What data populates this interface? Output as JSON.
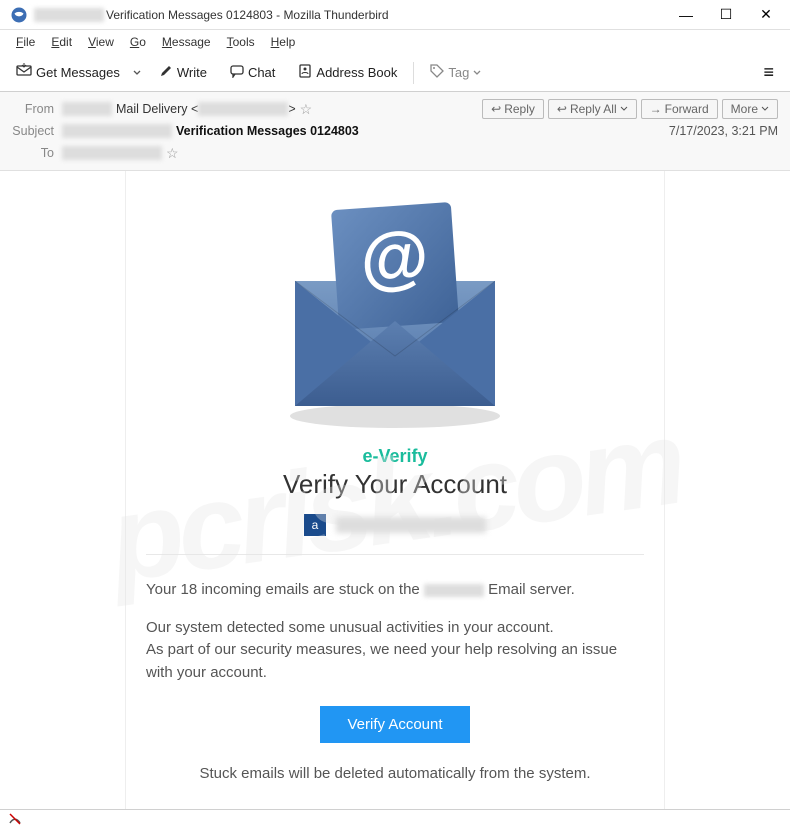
{
  "window": {
    "title_suffix": "Verification Messages 0124803 - Mozilla Thunderbird"
  },
  "menubar": {
    "file": "File",
    "edit": "Edit",
    "view": "View",
    "go": "Go",
    "message": "Message",
    "tools": "Tools",
    "help": "Help"
  },
  "toolbar": {
    "get_messages": "Get Messages",
    "write": "Write",
    "chat": "Chat",
    "address_book": "Address Book",
    "tag": "Tag"
  },
  "header": {
    "from_label": "From",
    "from_name": "Mail Delivery <",
    "from_closer": ">",
    "subject_label": "Subject",
    "subject_value": "Verification Messages 0124803",
    "to_label": "To",
    "date": "7/17/2023, 3:21 PM",
    "actions": {
      "reply": "Reply",
      "reply_all": "Reply All",
      "forward": "Forward",
      "more": "More"
    }
  },
  "body": {
    "everify": "e-Verify",
    "heading": "Verify Your Account",
    "acct_badge": "a",
    "line1_a": "Your 18 incoming emails are stuck on the ",
    "line1_b": " Email server.",
    "para2": "Our system detected some unusual activities in your account.",
    "para3": "As part of our security measures, we need your help resolving an issue with your account.",
    "button": "Verify Account",
    "footer": "Stuck emails will be deleted automatically from the system."
  }
}
